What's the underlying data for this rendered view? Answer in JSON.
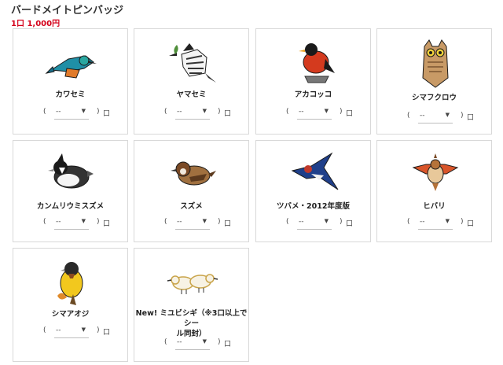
{
  "page": {
    "title": "バードメイトピンバッジ",
    "price": "1口 1,000円"
  },
  "items": [
    {
      "name": "カワセミ",
      "icon": "kingfisher-pin-icon",
      "qty": "--",
      "open": "(",
      "close": ")",
      "unit": "口"
    },
    {
      "name": "ヤマセミ",
      "icon": "crested-kingfisher-pin-icon",
      "qty": "--",
      "open": "(",
      "close": ")",
      "unit": "口"
    },
    {
      "name": "アカコッコ",
      "icon": "izu-thrush-pin-icon",
      "qty": "--",
      "open": "(",
      "close": ")",
      "unit": "口"
    },
    {
      "name": "シマフクロウ",
      "icon": "blakistons-fish-owl-pin-icon",
      "qty": "--",
      "open": "(",
      "close": ")",
      "unit": "口"
    },
    {
      "name": "カンムリウミスズメ",
      "icon": "crested-murrelet-pin-icon",
      "qty": "--",
      "open": "(",
      "close": ")",
      "unit": "口"
    },
    {
      "name": "スズメ",
      "icon": "sparrow-pin-icon",
      "qty": "--",
      "open": "(",
      "close": ")",
      "unit": "口"
    },
    {
      "name": "ツバメ・2012年度版",
      "icon": "swallow-pin-icon",
      "qty": "--",
      "open": "(",
      "close": ")",
      "unit": "口"
    },
    {
      "name": "ヒバリ",
      "icon": "skylark-pin-icon",
      "qty": "--",
      "open": "(",
      "close": ")",
      "unit": "口"
    },
    {
      "name": "シマアオジ",
      "icon": "yellow-breasted-bunting-pin-icon",
      "qty": "--",
      "open": "(",
      "close": ")",
      "unit": "口"
    },
    {
      "name": "New! ミユビシギ（※3口以上でシール同封）",
      "name_line1": "New! ミユビシギ（※3口以上でシー",
      "name_line2": "ル同封）",
      "icon": "sanderling-pin-icon",
      "qty": "--",
      "open": "(",
      "close": ")",
      "unit": "口"
    }
  ],
  "colors": {
    "price": "#d4001a",
    "border": "#d8d8d8"
  }
}
